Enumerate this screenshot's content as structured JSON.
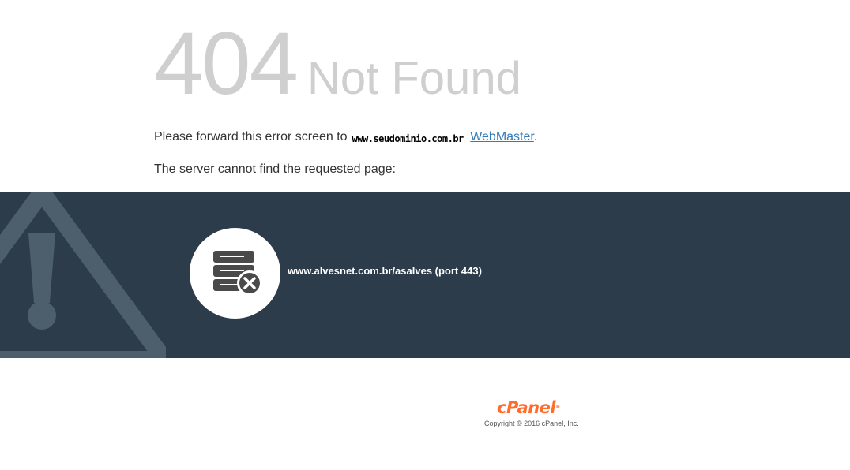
{
  "error": {
    "code": "404",
    "title": "Not Found"
  },
  "message": {
    "forward_prefix": "Please forward this error screen to",
    "domain": "www.seudominio.com.br",
    "webmaster_link": "WebMaster",
    "period": ".",
    "not_found_text": "The server cannot find the requested page:"
  },
  "banner": {
    "server_url": "www.alvesnet.com.br/asalves (port 443)",
    "background_color": "#2c3c4b",
    "server_icon": "server-error-icon",
    "warning_icon": "warning-triangle-icon"
  },
  "footer": {
    "logo": "cPanel",
    "logo_mark": "®",
    "copyright": "Copyright © 2016 cPanel, Inc.",
    "logo_color": "#ff6c2c"
  },
  "colors": {
    "link": "#337ab7",
    "heading": "#cfcfcf"
  }
}
